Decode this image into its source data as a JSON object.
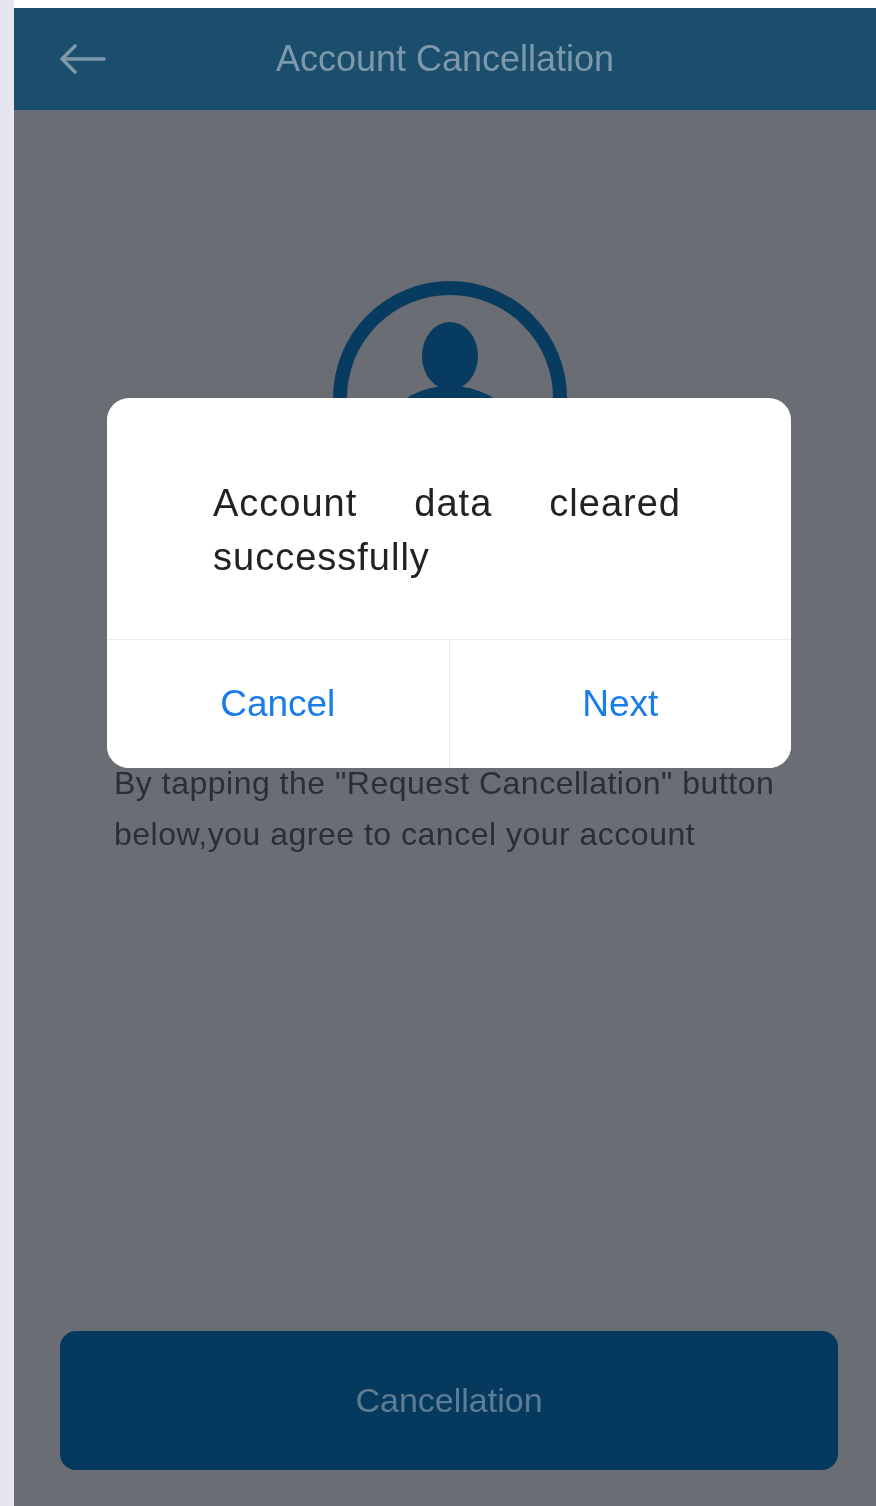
{
  "header": {
    "title": "Account Cancellation"
  },
  "dialog": {
    "message": "Account data cleared successfully",
    "buttons": [
      {
        "label": "Cancel"
      },
      {
        "label": "Next"
      }
    ]
  },
  "notice": "By tapping the \"Request Cancellation\" button below,you agree to cancel your account",
  "primary_button": {
    "label": "Cancellation"
  }
}
